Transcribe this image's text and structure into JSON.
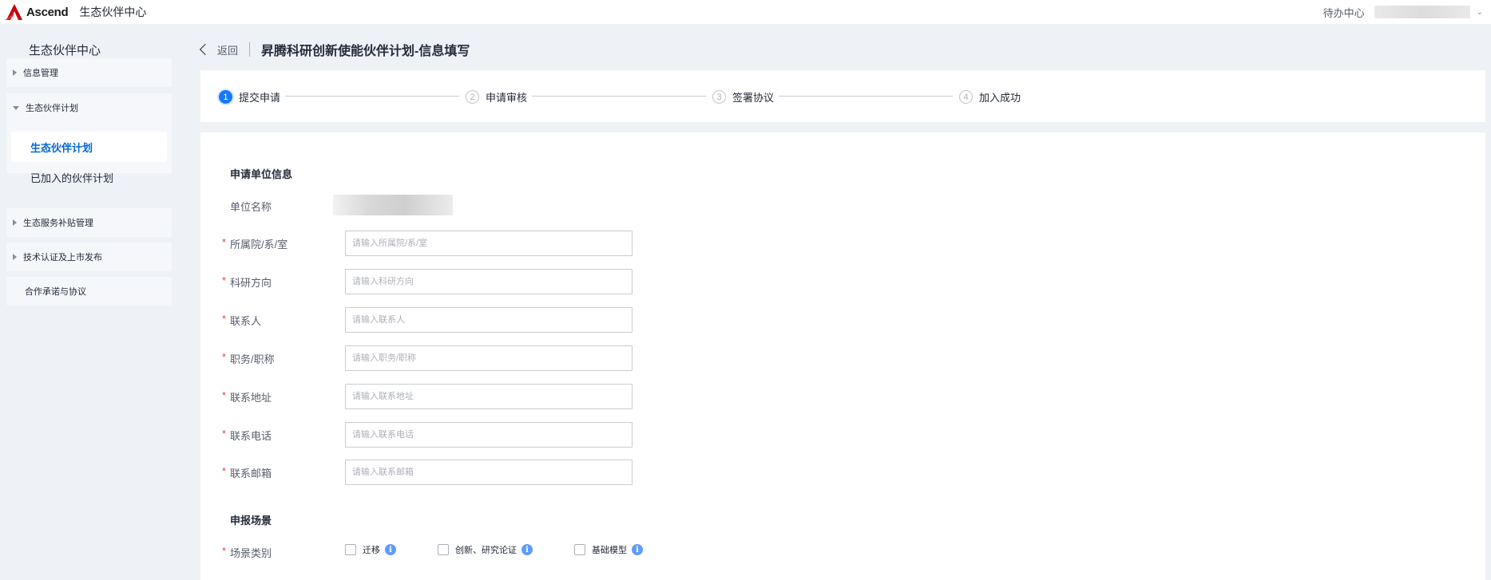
{
  "app": {
    "brand_name": "Ascend",
    "title": "生态伙伴中心",
    "todo_label": "待办中心",
    "brand_color": "#c7000b",
    "accent_color": "#1677ff"
  },
  "sidebar": {
    "title": "生态伙伴中心",
    "groups": [
      {
        "label": "信息管理",
        "expanded": false,
        "items": []
      },
      {
        "label": "生态伙伴计划",
        "expanded": true,
        "items": [
          {
            "label": "生态伙伴计划",
            "active": true
          },
          {
            "label": "已加入的伙伴计划",
            "active": false
          }
        ]
      },
      {
        "label": "生态服务补贴管理",
        "expanded": false,
        "items": []
      },
      {
        "label": "技术认证及上市发布",
        "expanded": false,
        "items": []
      },
      {
        "label": "合作承诺与协议",
        "expanded": false,
        "items": []
      }
    ]
  },
  "header": {
    "back_label": "返回",
    "page_title": "昇腾科研创新使能伙伴计划-信息填写"
  },
  "steps": [
    {
      "num": "1",
      "label": "提交申请",
      "active": true
    },
    {
      "num": "2",
      "label": "申请审核",
      "active": false
    },
    {
      "num": "3",
      "label": "签署协议",
      "active": false
    },
    {
      "num": "4",
      "label": "加入成功",
      "active": false
    }
  ],
  "form": {
    "section_applicant": "申请单位信息",
    "unit_name_label": "单位名称",
    "fields": [
      {
        "label": "所属院/系/室",
        "placeholder": "请输入所属院/系/室",
        "value": ""
      },
      {
        "label": "科研方向",
        "placeholder": "请输入科研方向",
        "value": ""
      },
      {
        "label": "联系人",
        "placeholder": "请输入联系人",
        "value": ""
      },
      {
        "label": "职务/职称",
        "placeholder": "请输入职务/职称",
        "value": ""
      },
      {
        "label": "联系地址",
        "placeholder": "请输入联系地址",
        "value": ""
      },
      {
        "label": "联系电话",
        "placeholder": "请输入联系电话",
        "value": ""
      },
      {
        "label": "联系邮箱",
        "placeholder": "请输入联系邮箱",
        "value": ""
      }
    ],
    "section_scenario": "申报场景",
    "scenario_label": "场景类别",
    "required_mark": "*",
    "scenario_options": [
      {
        "label": "迁移",
        "checked": false
      },
      {
        "label": "创新、研究论证",
        "checked": false
      },
      {
        "label": "基础模型",
        "checked": false
      }
    ],
    "info_glyph": "i"
  }
}
